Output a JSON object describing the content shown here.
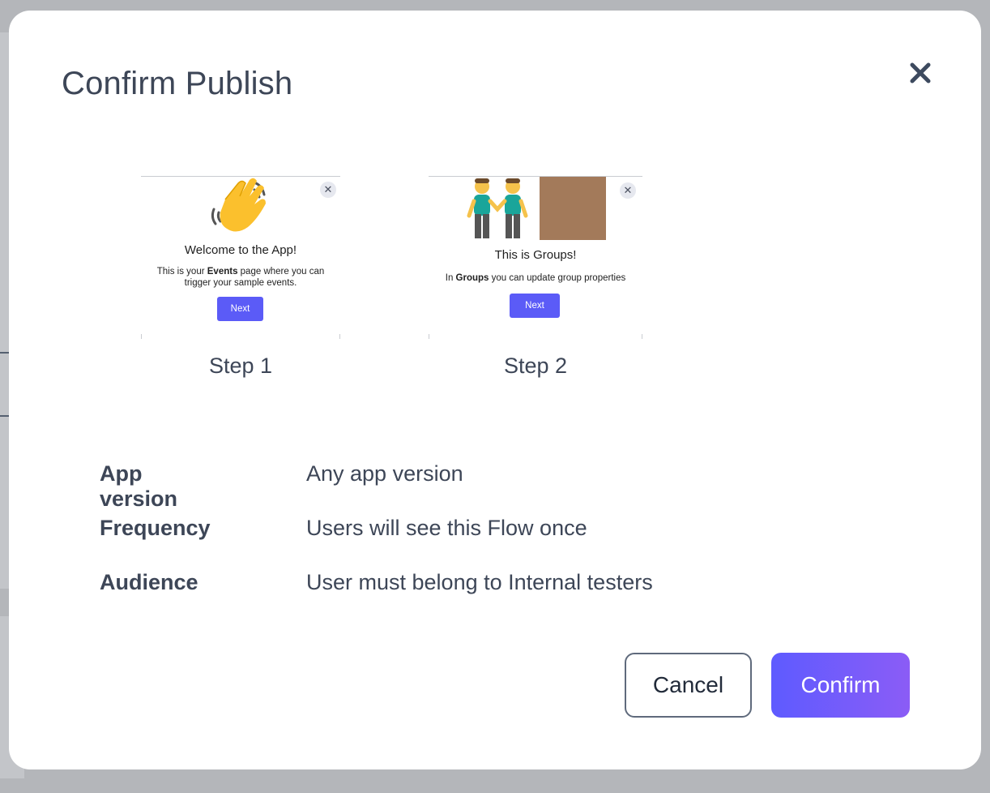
{
  "modal": {
    "title": "Confirm Publish",
    "close_icon": "close-icon"
  },
  "steps": [
    {
      "label": "Step 1",
      "preview": {
        "image_icon": "waving-hand-icon",
        "heading": "Welcome to the App!",
        "body_pre": "This is your ",
        "body_bold": "Events",
        "body_post": " page where you can trigger your sample events.",
        "button": "Next"
      }
    },
    {
      "label": "Step 2",
      "preview": {
        "image_icon": "two-men-holding-hands-icon",
        "heading": "This is Groups!",
        "body_pre": "In ",
        "body_bold": "Groups",
        "body_post": " you can update group properties",
        "button": "Next"
      }
    }
  ],
  "summary": [
    {
      "key": "App version",
      "value": "Any app version"
    },
    {
      "key": "Frequency",
      "value": "Users will see this Flow once"
    },
    {
      "key": "Audience",
      "value": "User must belong to Internal testers"
    }
  ],
  "actions": {
    "cancel": "Cancel",
    "confirm": "Confirm"
  },
  "colors": {
    "accent_start": "#5e5bff",
    "accent_end": "#8b5cf6",
    "text": "#3d4657"
  }
}
